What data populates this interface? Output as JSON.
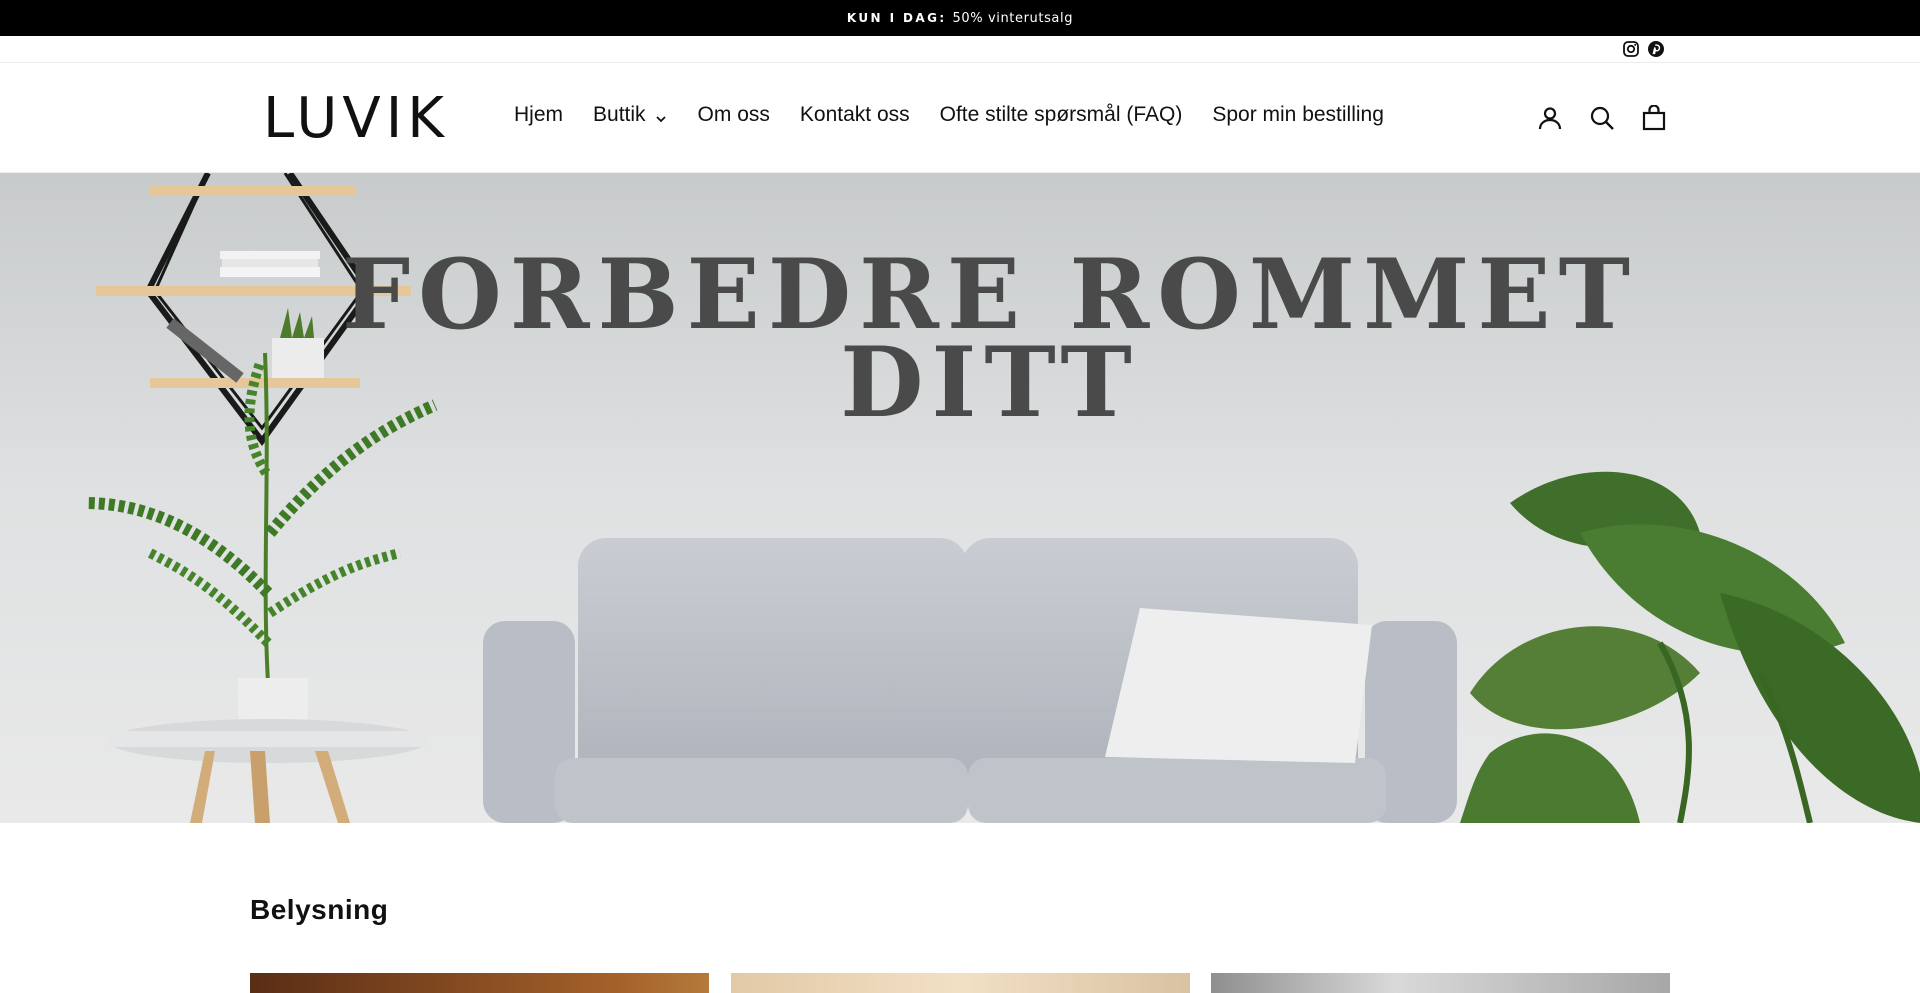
{
  "announcement": {
    "label": "KUN I DAG:",
    "text": "50% vinterutsalg"
  },
  "social": {
    "icons": [
      "instagram-icon",
      "pinterest-icon"
    ]
  },
  "header": {
    "logo": "LUVIK",
    "nav": [
      {
        "label": "Hjem"
      },
      {
        "label": "Buttik",
        "has_dropdown": true
      },
      {
        "label": "Om oss"
      },
      {
        "label": "Kontakt oss"
      },
      {
        "label": "Ofte stilte spørsmål (FAQ)"
      },
      {
        "label": "Spor min bestilling"
      }
    ],
    "icons": [
      "account-icon",
      "search-icon",
      "cart-icon"
    ]
  },
  "hero": {
    "title_line1": "FORBEDRE ROMMET",
    "title_line2": "DITT"
  },
  "collection": {
    "title": "Belysning"
  },
  "colors": {
    "announcement_bg": "#000000",
    "hero_text": "#4a4a4a",
    "sofa": "#c3c7cd",
    "plant": "#3e7a25"
  }
}
